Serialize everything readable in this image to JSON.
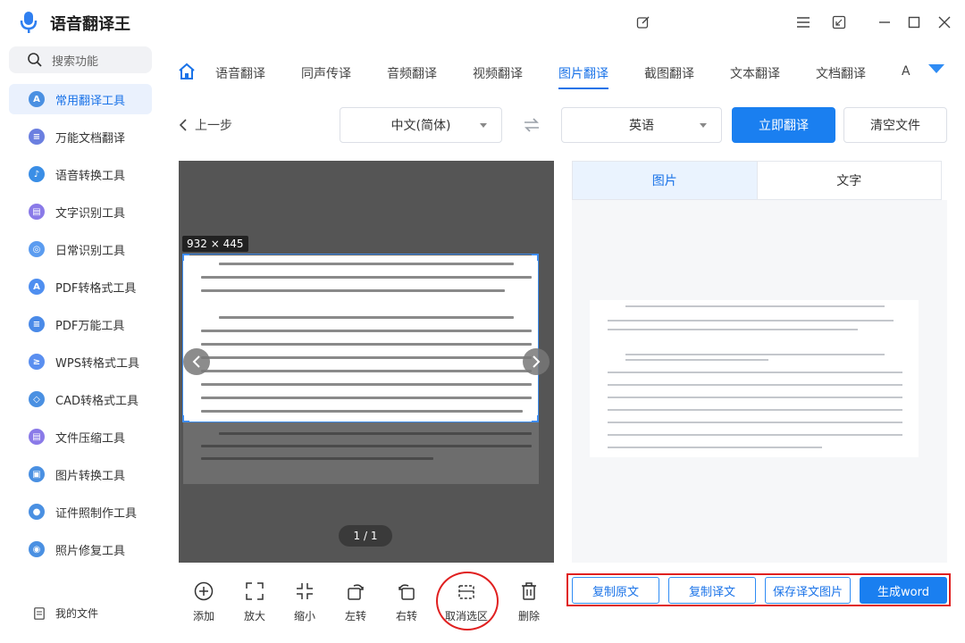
{
  "app": {
    "title": "语音翻译王"
  },
  "sidebar": {
    "search_placeholder": "搜索功能",
    "items": [
      {
        "label": "常用翻译工具",
        "icon": "translate-icon",
        "color": "#4a90e2",
        "active": true
      },
      {
        "label": "万能文档翻译",
        "icon": "document-icon",
        "color": "#6b7fe0"
      },
      {
        "label": "语音转换工具",
        "icon": "music-note-icon",
        "color": "#3a8ee6"
      },
      {
        "label": "文字识别工具",
        "icon": "file-icon",
        "color": "#8a7ae8"
      },
      {
        "label": "日常识别工具",
        "icon": "scan-icon",
        "color": "#5b9cf0"
      },
      {
        "label": "PDF转格式工具",
        "icon": "pdf-icon",
        "color": "#4f8ff0"
      },
      {
        "label": "PDF万能工具",
        "icon": "pdf-tools-icon",
        "color": "#4a8ae8"
      },
      {
        "label": "WPS转格式工具",
        "icon": "wps-icon",
        "color": "#5a8ff0"
      },
      {
        "label": "CAD转格式工具",
        "icon": "cad-icon",
        "color": "#4a90e2"
      },
      {
        "label": "文件压缩工具",
        "icon": "compress-icon",
        "color": "#8a7ae8"
      },
      {
        "label": "图片转换工具",
        "icon": "image-icon",
        "color": "#4a90e2"
      },
      {
        "label": "证件照制作工具",
        "icon": "id-photo-icon",
        "color": "#4a90e2"
      },
      {
        "label": "照片修复工具",
        "icon": "photo-repair-icon",
        "color": "#4a90e2"
      }
    ],
    "my_files": "我的文件"
  },
  "tabs": [
    {
      "label": "语音翻译"
    },
    {
      "label": "同声传译"
    },
    {
      "label": "音频翻译"
    },
    {
      "label": "视频翻译"
    },
    {
      "label": "图片翻译",
      "active": true
    },
    {
      "label": "截图翻译"
    },
    {
      "label": "文本翻译"
    },
    {
      "label": "文档翻译"
    },
    {
      "label": "A"
    }
  ],
  "controls": {
    "back": "上一步",
    "source_lang": "中文(简体)",
    "target_lang": "英语",
    "translate_button": "立即翻译",
    "clear_button": "清空文件"
  },
  "preview": {
    "size_badge": "932 × 445",
    "page_indicator": "1 / 1"
  },
  "result": {
    "tabs": [
      {
        "label": "图片",
        "active": true
      },
      {
        "label": "文字"
      }
    ]
  },
  "toolbar": [
    {
      "label": "添加",
      "icon": "add-icon"
    },
    {
      "label": "放大",
      "icon": "zoom-in-icon"
    },
    {
      "label": "缩小",
      "icon": "zoom-out-icon"
    },
    {
      "label": "左转",
      "icon": "rotate-left-icon"
    },
    {
      "label": "右转",
      "icon": "rotate-right-icon"
    },
    {
      "label": "取消选区",
      "icon": "cancel-selection-icon"
    },
    {
      "label": "删除",
      "icon": "delete-icon"
    }
  ],
  "actions": {
    "copy_source": "复制原文",
    "copy_translation": "复制译文",
    "save_image": "保存译文图片",
    "generate_word": "生成word"
  },
  "colors": {
    "accent": "#1a7ff0",
    "highlight": "#e02020"
  }
}
